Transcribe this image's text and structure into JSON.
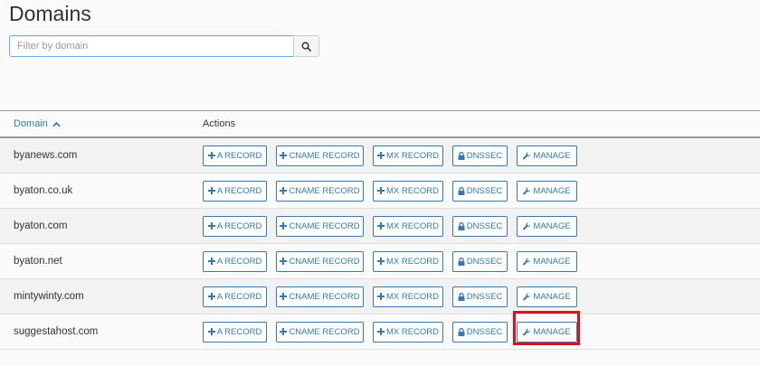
{
  "page": {
    "title": "Domains"
  },
  "search": {
    "placeholder": "Filter by domain",
    "value": "",
    "icon": "search-icon"
  },
  "table": {
    "columns": {
      "domain": "Domain",
      "sort_icon": "chevron-up-icon",
      "actions": "Actions"
    },
    "action_labels": {
      "a_record": "A RECORD",
      "cname_record": "CNAME RECORD",
      "mx_record": "MX RECORD",
      "dnssec": "DNSSEC",
      "manage": "MANAGE"
    },
    "rows": [
      {
        "domain": "byanews.com"
      },
      {
        "domain": "byaton.co.uk"
      },
      {
        "domain": "byaton.com"
      },
      {
        "domain": "byaton.net"
      },
      {
        "domain": "mintywinty.com"
      },
      {
        "domain": "suggestahost.com",
        "highlighted_action": "manage"
      }
    ]
  },
  "colors": {
    "accent": "#337ab7",
    "highlight": "#e0101a"
  }
}
